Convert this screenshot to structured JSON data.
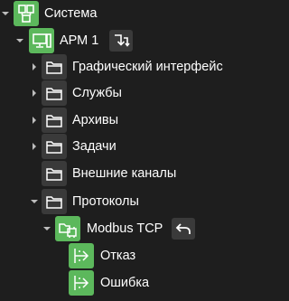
{
  "tree": {
    "root": {
      "label": "Система",
      "icon": "network-icon"
    },
    "arm": {
      "label": "АРМ 1",
      "icon": "workstation-icon",
      "action_icon": "distribute-icon"
    },
    "items": [
      {
        "label": "Графический интерфейс",
        "icon": "folder-icon"
      },
      {
        "label": "Службы",
        "icon": "folder-icon"
      },
      {
        "label": "Архивы",
        "icon": "folder-icon"
      },
      {
        "label": "Задачи",
        "icon": "folder-icon"
      },
      {
        "label": "Внешние каналы",
        "icon": "folder-icon"
      },
      {
        "label": "Протоколы",
        "icon": "folder-icon"
      }
    ],
    "protocol": {
      "label": "Modbus TCP",
      "icon": "modbus-icon",
      "action_icon": "undo-icon"
    },
    "channels": [
      {
        "label": "Отказ",
        "icon": "export-icon"
      },
      {
        "label": "Ошибка",
        "icon": "export-icon"
      }
    ]
  },
  "colors": {
    "background": "#1e1e1e",
    "icon_dark": "#3a3a3a",
    "icon_green": "#5cb85c",
    "text": "#ffffff"
  }
}
